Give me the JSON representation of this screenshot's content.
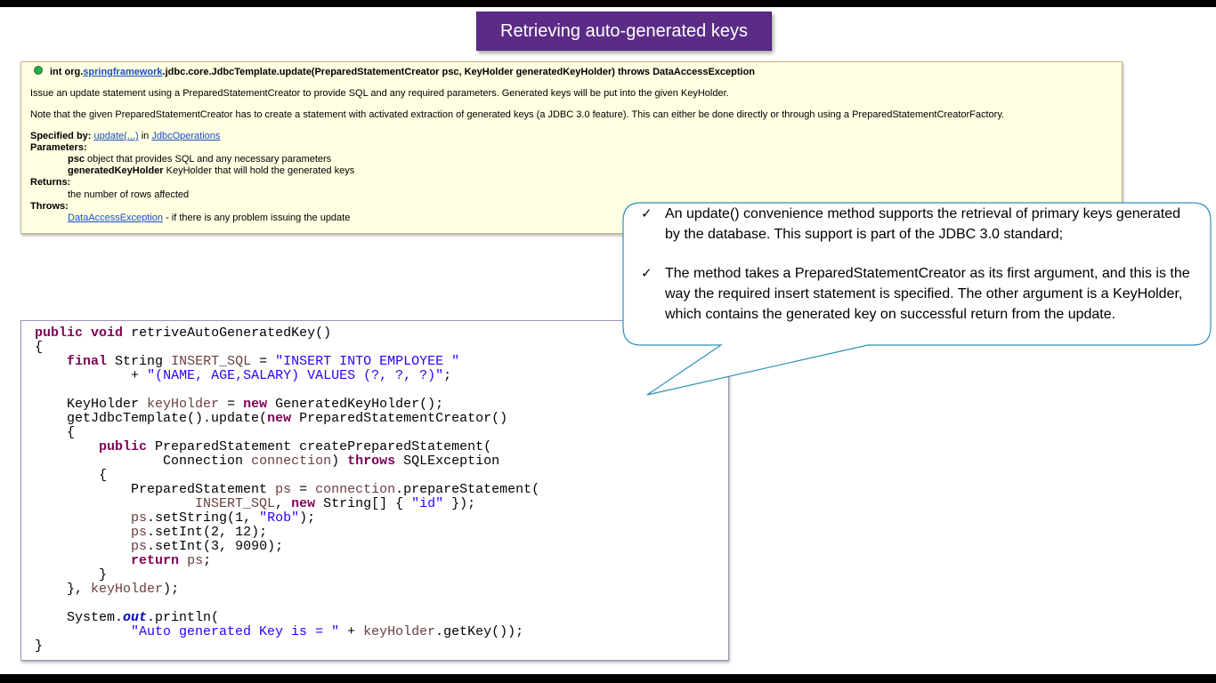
{
  "slide": {
    "title": "Retrieving auto-generated keys"
  },
  "javadoc": {
    "signature_prefix": "int org.",
    "signature_link": "springframework",
    "signature_rest": ".jdbc.core.JdbcTemplate.update(PreparedStatementCreator psc, KeyHolder generatedKeyHolder) throws DataAccessException",
    "description": "Issue an update statement using a PreparedStatementCreator to provide SQL and any required parameters. Generated keys will be put into the given KeyHolder.",
    "note": "Note that the given PreparedStatementCreator has to create a statement with activated extraction of generated keys (a JDBC 3.0 feature). This can either be done directly or through using a PreparedStatementCreatorFactory.",
    "specified_by_label": "Specified by:",
    "specified_by_link1": "update(...)",
    "specified_by_in": "in",
    "specified_by_link2": "JdbcOperations",
    "parameters_label": "Parameters:",
    "param1_name": "psc",
    "param1_desc": "object that provides SQL and any necessary parameters",
    "param2_name": "generatedKeyHolder",
    "param2_desc": "KeyHolder that will hold the generated keys",
    "returns_label": "Returns:",
    "returns_desc": "the number of rows affected",
    "throws_label": "Throws:",
    "throws_link": "DataAccessException",
    "throws_desc": "- if there is any problem issuing the update"
  },
  "code": {
    "l1_kw1": "public",
    "l1_kw2": "void",
    "l1_rest": "retriveAutoGeneratedKey()",
    "l2": "{",
    "l3_kw": "final",
    "l3_type": "String",
    "l3_var": "INSERT_SQL",
    "l3_eq": "=",
    "l3_str": "\"INSERT INTO EMPLOYEE \"",
    "l4_plus": "+",
    "l4_str": "\"(NAME, AGE,SALARY) VALUES (?, ?, ?)\"",
    "l4_end": ";",
    "l6_type": "KeyHolder",
    "l6_var": "keyHolder",
    "l6_eq": "=",
    "l6_kw": "new",
    "l6_rest": "GeneratedKeyHolder();",
    "l7_a": "getJdbcTemplate().update(",
    "l7_kw": "new",
    "l7_b": "PreparedStatementCreator()",
    "l8": "{",
    "l9_kw": "public",
    "l9_rest": "PreparedStatement createPreparedStatement(",
    "l10_a": "Connection",
    "l10_var": "connection",
    "l10_kw": "throws",
    "l10_b": "SQLException",
    "l11": "{",
    "l12_a": "PreparedStatement",
    "l12_var": "ps",
    "l12_eq": "=",
    "l12_var2": "connection",
    "l12_b": ".prepareStatement(",
    "l13_var": "INSERT_SQL",
    "l13_comma": ",",
    "l13_kw": "new",
    "l13_a": "String[] {",
    "l13_str": "\"id\"",
    "l13_end": "});",
    "l14_var": "ps",
    "l14_a": ".setString(1,",
    "l14_str": "\"Rob\"",
    "l14_end": ");",
    "l15_var": "ps",
    "l15_a": ".setInt(2, 12);",
    "l16_var": "ps",
    "l16_a": ".setInt(3, 9090);",
    "l17_kw": "return",
    "l17_var": "ps",
    "l17_end": ";",
    "l18": "}",
    "l19_a": "},",
    "l19_var": "keyHolder",
    "l19_end": ");",
    "l21_a": "System.",
    "l21_fld": "out",
    "l21_b": ".println(",
    "l22_str": "\"Auto generated Key is = \"",
    "l22_plus": "+",
    "l22_var": "keyHolder",
    "l22_end": ".getKey());",
    "l23": "}"
  },
  "callout": {
    "bullet1": "An update() convenience method supports the retrieval of primary keys generated by the database. This support is part of the JDBC 3.0 standard;",
    "bullet2": "The method takes a PreparedStatementCreator as its first argument, and this is the way the required insert statement is specified. The other argument is a KeyHolder, which contains the generated key on successful return from the update."
  }
}
